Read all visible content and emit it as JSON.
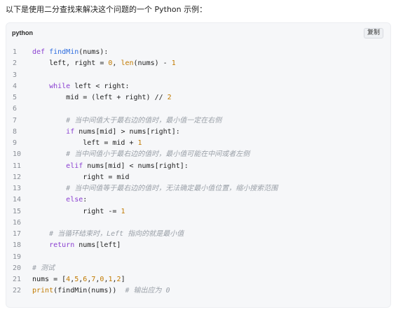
{
  "intro_text": "以下是使用二分查找来解决这个问题的一个 Python 示例：",
  "code_block": {
    "language": "python",
    "copy_label": "复制",
    "lines": [
      [
        {
          "t": "def ",
          "c": "kw"
        },
        {
          "t": "findMin",
          "c": "fn"
        },
        {
          "t": "(nums):",
          "c": ""
        }
      ],
      [
        {
          "t": "    left, right = ",
          "c": ""
        },
        {
          "t": "0",
          "c": "num"
        },
        {
          "t": ", ",
          "c": ""
        },
        {
          "t": "len",
          "c": "bi"
        },
        {
          "t": "(nums) - ",
          "c": ""
        },
        {
          "t": "1",
          "c": "num"
        }
      ],
      [],
      [
        {
          "t": "    ",
          "c": ""
        },
        {
          "t": "while",
          "c": "kw"
        },
        {
          "t": " left < right:",
          "c": ""
        }
      ],
      [
        {
          "t": "        mid = (left + right) // ",
          "c": ""
        },
        {
          "t": "2",
          "c": "num"
        }
      ],
      [],
      [
        {
          "t": "        # 当中间值大于最右边的值时，最小值一定在右侧",
          "c": "cm"
        }
      ],
      [
        {
          "t": "        ",
          "c": ""
        },
        {
          "t": "if",
          "c": "kw"
        },
        {
          "t": " nums[mid] > nums[right]:",
          "c": ""
        }
      ],
      [
        {
          "t": "            left = mid + ",
          "c": ""
        },
        {
          "t": "1",
          "c": "num"
        }
      ],
      [
        {
          "t": "        # 当中间值小于最右边的值时，最小值可能在中间或者左侧",
          "c": "cm"
        }
      ],
      [
        {
          "t": "        ",
          "c": ""
        },
        {
          "t": "elif",
          "c": "kw"
        },
        {
          "t": " nums[mid] < nums[right]:",
          "c": ""
        }
      ],
      [
        {
          "t": "            right = mid",
          "c": ""
        }
      ],
      [
        {
          "t": "        # 当中间值等于最右边的值时，无法确定最小值位置，缩小搜索范围",
          "c": "cm"
        }
      ],
      [
        {
          "t": "        ",
          "c": ""
        },
        {
          "t": "else",
          "c": "kw"
        },
        {
          "t": ":",
          "c": ""
        }
      ],
      [
        {
          "t": "            right -= ",
          "c": ""
        },
        {
          "t": "1",
          "c": "num"
        }
      ],
      [],
      [
        {
          "t": "    # 当循环结束时，Left 指向的就是最小值",
          "c": "cm"
        }
      ],
      [
        {
          "t": "    ",
          "c": ""
        },
        {
          "t": "return",
          "c": "kw"
        },
        {
          "t": " nums[left]",
          "c": ""
        }
      ],
      [],
      [
        {
          "t": "# 测试",
          "c": "cm"
        }
      ],
      [
        {
          "t": "nums = [",
          "c": ""
        },
        {
          "t": "4",
          "c": "num"
        },
        {
          "t": ",",
          "c": ""
        },
        {
          "t": "5",
          "c": "num"
        },
        {
          "t": ",",
          "c": ""
        },
        {
          "t": "6",
          "c": "num"
        },
        {
          "t": ",",
          "c": ""
        },
        {
          "t": "7",
          "c": "num"
        },
        {
          "t": ",",
          "c": ""
        },
        {
          "t": "0",
          "c": "num"
        },
        {
          "t": ",",
          "c": ""
        },
        {
          "t": "1",
          "c": "num"
        },
        {
          "t": ",",
          "c": ""
        },
        {
          "t": "2",
          "c": "num"
        },
        {
          "t": "]",
          "c": ""
        }
      ],
      [
        {
          "t": "print",
          "c": "bi"
        },
        {
          "t": "(findMin(nums))  ",
          "c": ""
        },
        {
          "t": "# 输出应为 0",
          "c": "cm"
        }
      ]
    ]
  },
  "colors": {
    "keyword": "#8a3fd1",
    "function": "#2d6cdf",
    "number": "#c27a00",
    "comment": "#9aa0a8",
    "card_background": "#f6f7f9"
  }
}
